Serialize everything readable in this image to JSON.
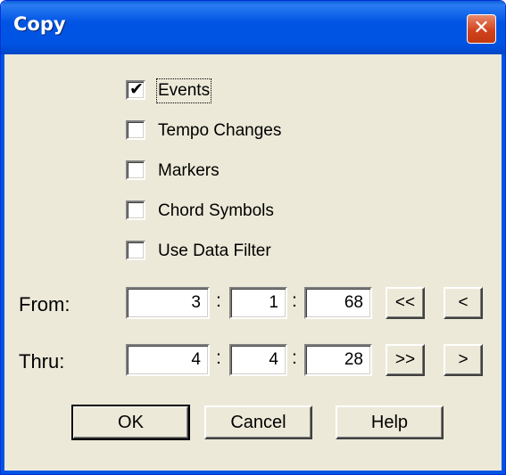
{
  "window": {
    "title": "Copy",
    "close_glyph": "✕"
  },
  "checkboxes": [
    {
      "label": "Events",
      "checked": true
    },
    {
      "label": "Tempo Changes",
      "checked": false
    },
    {
      "label": "Markers",
      "checked": false
    },
    {
      "label": "Chord Symbols",
      "checked": false
    },
    {
      "label": "Use Data Filter",
      "checked": false
    }
  ],
  "checkmark_glyph": "✔",
  "from": {
    "label": "From:",
    "bar": "3",
    "beat": "1",
    "tick": "68",
    "btn1": "<<",
    "btn2": "<"
  },
  "thru": {
    "label": "Thru:",
    "bar": "4",
    "beat": "4",
    "tick": "28",
    "btn1": ">>",
    "btn2": ">"
  },
  "separator": ":",
  "buttons": {
    "ok": "OK",
    "cancel": "Cancel",
    "help": "Help"
  },
  "colors": {
    "titlebar": "#0054e3",
    "dialog_bg": "#ece9d8",
    "close": "#d2431e"
  }
}
